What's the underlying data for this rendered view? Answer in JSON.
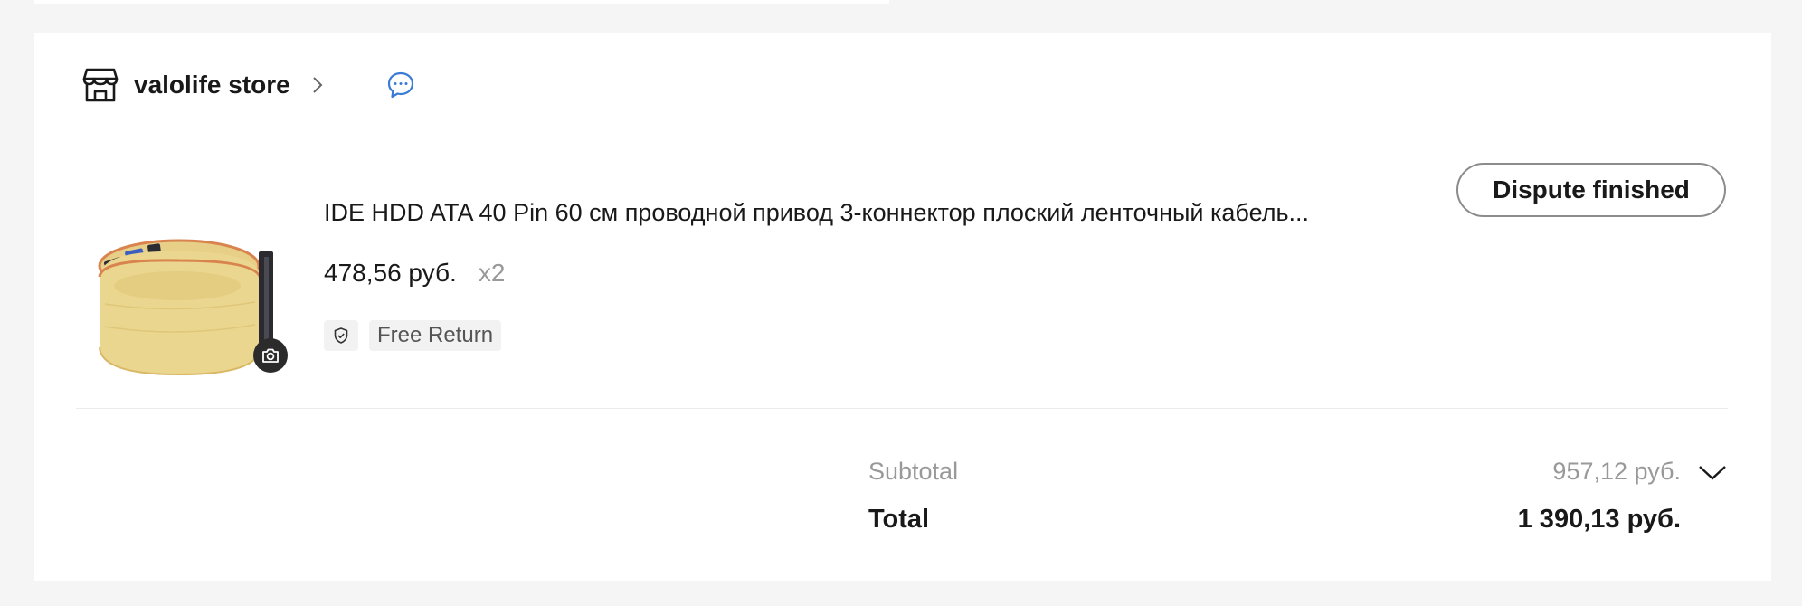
{
  "store": {
    "name": "valolife store",
    "icon": "store-icon",
    "chevron_icon": "chevron-right-icon",
    "chat_icon": "chat-bubble-icon",
    "chat_color": "#3a7bd5"
  },
  "order_item": {
    "title": "IDE HDD ATA 40 Pin 60 см проводной привод 3-коннектор плоский ленточный кабель...",
    "price": "478,56 руб.",
    "quantity": "x2",
    "image_alt": "IDE ribbon cable",
    "camera_icon": "camera-icon",
    "tags": {
      "shield_icon": "shield-check-icon",
      "free_return": "Free Return"
    },
    "action_button": "Dispute finished"
  },
  "summary": {
    "subtotal_label": "Subtotal",
    "subtotal_value": "957,12 руб.",
    "total_label": "Total",
    "total_value": "1 390,13 руб.",
    "expand_icon": "chevron-down-icon"
  }
}
